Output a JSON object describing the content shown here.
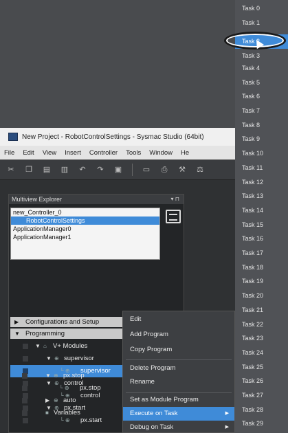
{
  "tasks": [
    "Task 0",
    "Task 1",
    "Task 2",
    "Task 3",
    "Task 4",
    "Task 5",
    "Task 6",
    "Task 7",
    "Task 8",
    "Task 9",
    "Task 10",
    "Task 11",
    "Task 12",
    "Task 13",
    "Task 14",
    "Task 15",
    "Task 16",
    "Task 17",
    "Task 18",
    "Task 19",
    "Task 20",
    "Task 21",
    "Task 22",
    "Task 23",
    "Task 24",
    "Task 25",
    "Task 26",
    "Task 27",
    "Task 28",
    "Task 29"
  ],
  "selected_task": "Task 2",
  "window": {
    "title": "New Project - RobotControlSettings - Sysmac Studio (64bit)",
    "menu": [
      "File",
      "Edit",
      "View",
      "Insert",
      "Controller",
      "Tools",
      "Window",
      "He"
    ]
  },
  "toolbar": {
    "icons": [
      "cut-icon",
      "copy-icon",
      "paste-icon",
      "delete-icon",
      "undo-icon",
      "redo-icon",
      "save-icon",
      "monitor-icon",
      "print-icon",
      "build-icon",
      "compare-icon"
    ]
  },
  "explorer": {
    "title": "Multiview Explorer",
    "pin": "▾ ⊓",
    "devices": [
      "new_Controller_0",
      "RobotControlSettings",
      "ApplicationManager0",
      "ApplicationManager1"
    ],
    "sections": {
      "config": "Configurations and Setup",
      "programming": "Programming"
    },
    "tree": {
      "vplus": "V+ Modules",
      "supervisor_mod": "supervisor",
      "supervisor_prog": "supervisor",
      "control_mod": "control",
      "control_prog": "control",
      "pxstart_mod": "px.start",
      "pxstart_prog": "px.start",
      "pxstop_mod": "px.stop",
      "pxstop_prog": "px.stop",
      "auto_mod": "auto",
      "variables": "Variables"
    }
  },
  "context_menu": {
    "edit": "Edit",
    "add_program": "Add Program",
    "copy_program": "Copy Program",
    "delete_program": "Delete Program",
    "rename": "Rename",
    "set_module_program": "Set as Module Program",
    "execute_on_task": "Execute on Task",
    "debug_on_task": "Debug on Task"
  },
  "colors": {
    "accent": "#3f8bd8",
    "panel": "#505256"
  }
}
